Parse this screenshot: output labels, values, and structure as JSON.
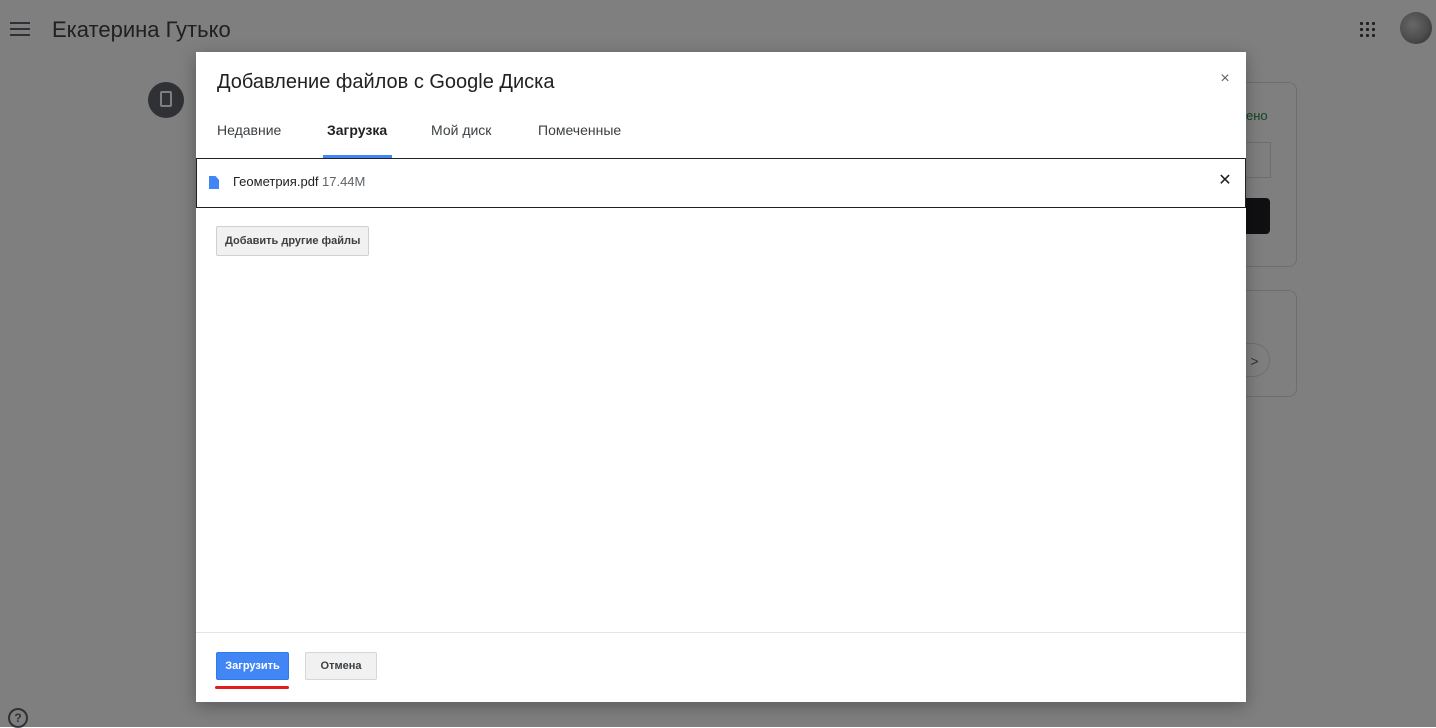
{
  "header": {
    "user_name": "Екатерина Гутько",
    "menu_icon": "hamburger-menu-icon",
    "apps_icon": "apps-grid-icon",
    "avatar_icon": "account-avatar"
  },
  "background": {
    "status_text": "ено",
    "send_icon": ">",
    "help_icon": "?"
  },
  "dialog": {
    "title": "Добавление файлов с Google Диска",
    "close_label": "×",
    "tabs": [
      {
        "label": "Недавние",
        "active": false
      },
      {
        "label": "Загрузка",
        "active": true
      },
      {
        "label": "Мой диск",
        "active": false
      },
      {
        "label": "Помеченные",
        "active": false
      }
    ],
    "file": {
      "name": "Геометрия.pdf",
      "size": "17.44M",
      "icon": "file-doc-icon",
      "remove_label": "✕"
    },
    "add_more_label": "Добавить другие файлы",
    "upload_label": "Загрузить",
    "cancel_label": "Отмена"
  },
  "colors": {
    "accent": "#4285f4",
    "annotation_underline": "#e11d1d",
    "overlay": "rgba(0,0,0,0.5)"
  }
}
